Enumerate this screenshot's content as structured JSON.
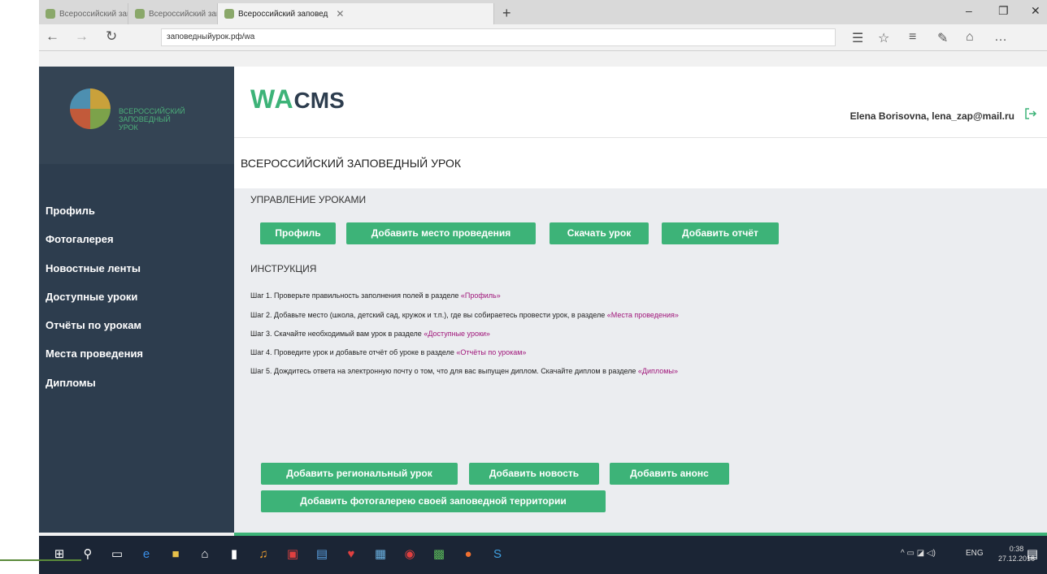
{
  "browser": {
    "tabs": [
      {
        "label": "Всероссийский заповедник"
      },
      {
        "label": "Всероссийский заповедн"
      },
      {
        "label": "Всероссийский заповед"
      }
    ],
    "address": "заповедныйурок.рф/wa"
  },
  "sidebar": {
    "logo_text_line1": "всероссийский",
    "logo_text_line2": "заповедный",
    "logo_text_line3": "урок",
    "items": [
      {
        "label": "Профиль"
      },
      {
        "label": "Фотогалерея"
      },
      {
        "label": "Новостные ленты"
      },
      {
        "label": "Доступные уроки"
      },
      {
        "label": "Отчёты по урокам"
      },
      {
        "label": "Места проведения"
      },
      {
        "label": "Дипломы"
      }
    ]
  },
  "header": {
    "brand_wa": "WA",
    "brand_cms": "CMS",
    "user": "Elena Borisovna, lena_zap@mail.ru",
    "page_title": "ВСЕРОССИЙСКИЙ ЗАПОВЕДНЫЙ УРОК"
  },
  "management": {
    "title": "УПРАВЛЕНИЕ УРОКАМИ",
    "buttons": [
      "Профиль",
      "Добавить место проведения",
      "Скачать урок",
      "Добавить отчёт"
    ]
  },
  "instructions": {
    "title": "ИНСТРУКЦИЯ",
    "steps": [
      {
        "text": "Шаг 1. Проверьте правильность заполнения полей в разделе ",
        "link": "«Профиль»",
        "after": ""
      },
      {
        "text": "Шаг 2. Добавьте место (школа, детский сад, кружок и т.п.), где вы собираетесь провести урок, в разделе ",
        "link": "«Места проведения»",
        "after": ""
      },
      {
        "text": "Шаг 3. Скачайте необходимый вам урок в разделе ",
        "link": "«Доступные уроки»",
        "after": ""
      },
      {
        "text": "Шаг 4. Проведите урок и добавьте отчёт об уроке в разделе ",
        "link": "«Отчёты по урокам»",
        "after": ""
      },
      {
        "text": "Шаг 5. Дождитесь ответа на электронную почту о том, что для вас выпущен диплом. Скачайте диплом в разделе ",
        "link": "«Дипломы»",
        "after": ""
      }
    ]
  },
  "bottom_buttons": [
    "Добавить региональный урок",
    "Добавить новость",
    "Добавить анонс",
    "Добавить фотогалерею своей заповедной территории"
  ],
  "taskbar": {
    "lang": "ENG",
    "time": "0:38",
    "date": "27.12.2016"
  },
  "colors": {
    "accent": "#3db378",
    "sidebar": "#2d3d4e",
    "link": "#a0167a"
  }
}
